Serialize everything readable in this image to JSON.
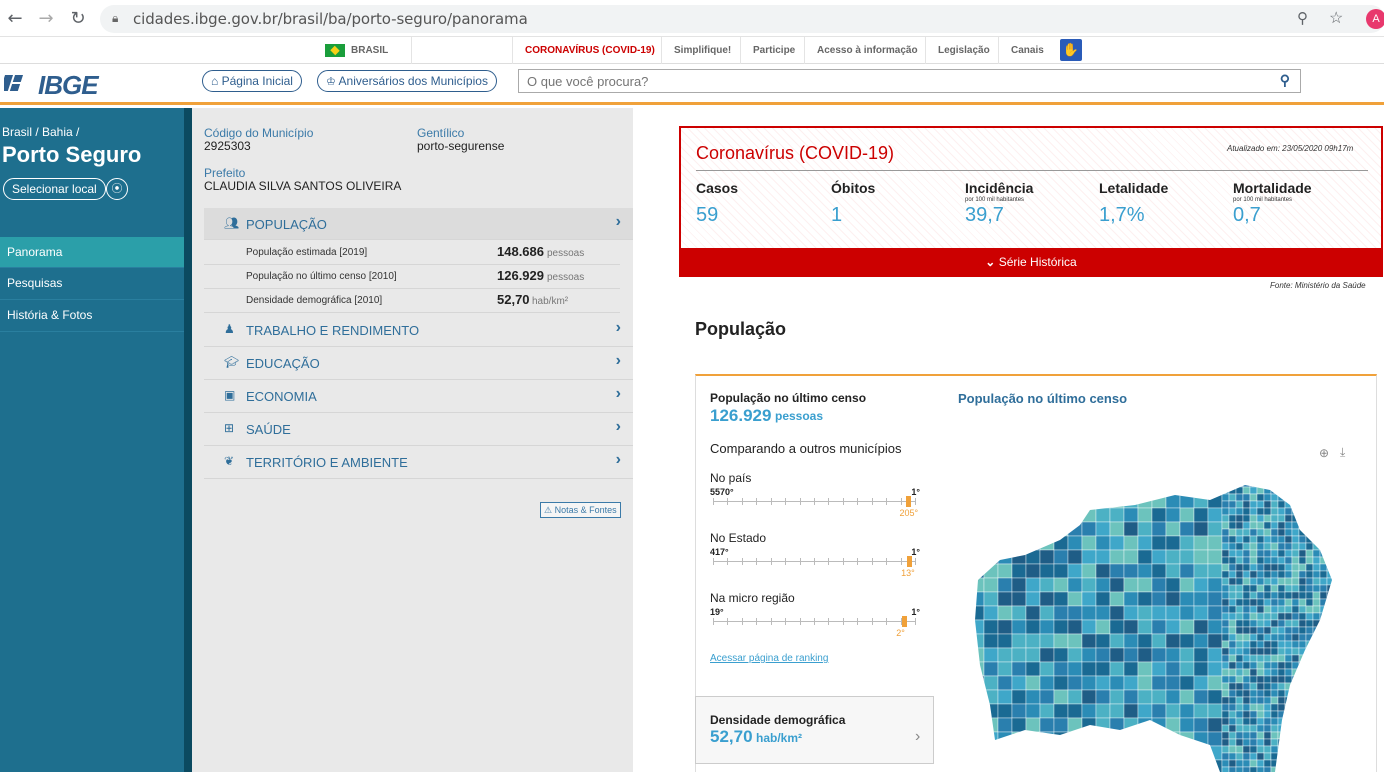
{
  "browser": {
    "url": "cidades.ibge.gov.br/brasil/ba/porto-seguro/panorama",
    "avatar_letter": "A"
  },
  "govbar": {
    "brasil": "BRASIL",
    "items": [
      "CORONAVÍRUS (COVID-19)",
      "Simplifique!",
      "Participe",
      "Acesso à informação",
      "Legislação",
      "Canais"
    ]
  },
  "header": {
    "logo": "IBGE",
    "home_button": "Página Inicial",
    "anniv_button": "Aniversários dos Municípios",
    "search_placeholder": "O que você procura?"
  },
  "sidebar": {
    "breadcrumb": "Brasil / Bahia /",
    "city": "Porto Seguro",
    "select_button": "Selecionar local",
    "items": [
      "Panorama",
      "Pesquisas",
      "História & Fotos"
    ]
  },
  "municipio": {
    "codigo_label": "Código do Município",
    "codigo": "2925303",
    "gentilico_label": "Gentílico",
    "gentilico": "porto-segurense",
    "prefeito_label": "Prefeito",
    "prefeito": "CLAUDIA SILVA SANTOS OLIVEIRA"
  },
  "sections": {
    "populacao": "POPULAÇÃO",
    "trabalho": "TRABALHO E RENDIMENTO",
    "educacao": "EDUCAÇÃO",
    "economia": "ECONOMIA",
    "saude": "SAÚDE",
    "territorio": "TERRITÓRIO E AMBIENTE"
  },
  "pop_rows": [
    {
      "label": "População estimada [2019]",
      "value": "148.686",
      "unit": "pessoas"
    },
    {
      "label": "População no último censo [2010]",
      "value": "126.929",
      "unit": "pessoas"
    },
    {
      "label": "Densidade demográfica [2010]",
      "value": "52,70",
      "unit": "hab/km²"
    }
  ],
  "notas": "Notas & Fontes",
  "covid": {
    "title": "Coronavírus (COVID-19)",
    "updated": "Atualizado em: 23/05/2020 09h17m",
    "stats": [
      {
        "label": "Casos",
        "sub": "",
        "value": "59"
      },
      {
        "label": "Óbitos",
        "sub": "",
        "value": "1"
      },
      {
        "label": "Incidência",
        "sub": "por 100 mil habitantes",
        "value": "39,7"
      },
      {
        "label": "Letalidade",
        "sub": "",
        "value": "1,7%"
      },
      {
        "label": "Mortalidade",
        "sub": "por 100 mil habitantes",
        "value": "0,7"
      }
    ],
    "serie": "Série Histórica",
    "fonte": "Fonte: Ministério da Saúde"
  },
  "populacao": {
    "title": "População",
    "card_label": "População no último censo",
    "card_value": "126.929",
    "card_unit": "pessoas",
    "compare_title": "Comparando a outros municípios",
    "ranks": [
      {
        "label": "No país",
        "total": "5570°",
        "first": "1°",
        "pos": "205°",
        "fraction": 0.963
      },
      {
        "label": "No Estado",
        "total": "417°",
        "first": "1°",
        "pos": "13°",
        "fraction": 0.971
      },
      {
        "label": "Na micro região",
        "total": "19°",
        "first": "1°",
        "pos": "2°",
        "fraction": 0.947
      }
    ],
    "rank_link": "Acessar página de ranking",
    "dens_label": "Densidade demográfica",
    "dens_value": "52,70",
    "dens_unit": "hab/km²",
    "map_title": "População no último censo"
  },
  "colors": {
    "sidebar": "#1e6f8e",
    "active": "#2b9fa9",
    "covid_red": "#cc0000",
    "accent_orange": "#f0a13a",
    "value_blue": "#3a9fcf"
  }
}
